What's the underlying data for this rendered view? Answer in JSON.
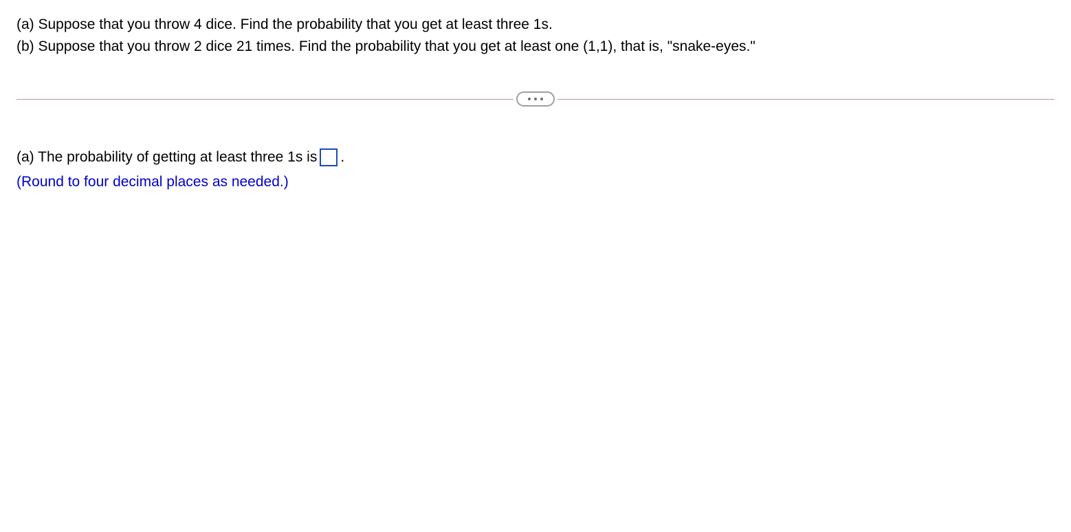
{
  "question": {
    "partA": "(a) Suppose that you throw 4 dice. Find the probability that you get at least three 1s.",
    "partB": "(b) Suppose that you throw 2 dice 21 times. Find the probability that you get at least one (1,1), that is, \"snake-eyes.\""
  },
  "answer": {
    "prefix": "(a) The probability of getting at least three 1s is",
    "suffix": ".",
    "hint": "(Round to four decimal places as needed.)",
    "inputValue": ""
  }
}
